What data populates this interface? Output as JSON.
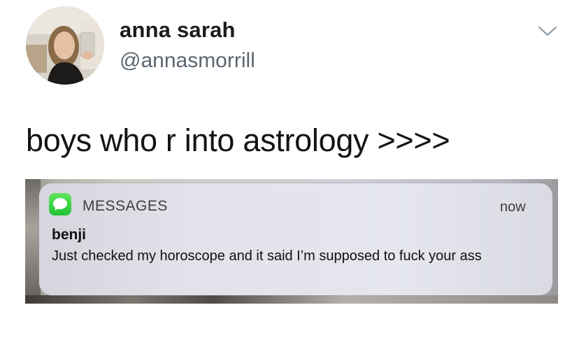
{
  "tweet": {
    "author": {
      "display_name": "anna sarah",
      "handle": "@annasmorrill"
    },
    "text": "boys who r into astrology >>>>",
    "menu_icon": "chevron-down-icon"
  },
  "notification": {
    "app_icon": "messages-app-icon",
    "app_name": "MESSAGES",
    "time": "now",
    "sender": "benji",
    "message": "Just checked my horoscope and it said I’m supposed to fuck your ass",
    "accent_color": "#2ac83b"
  }
}
